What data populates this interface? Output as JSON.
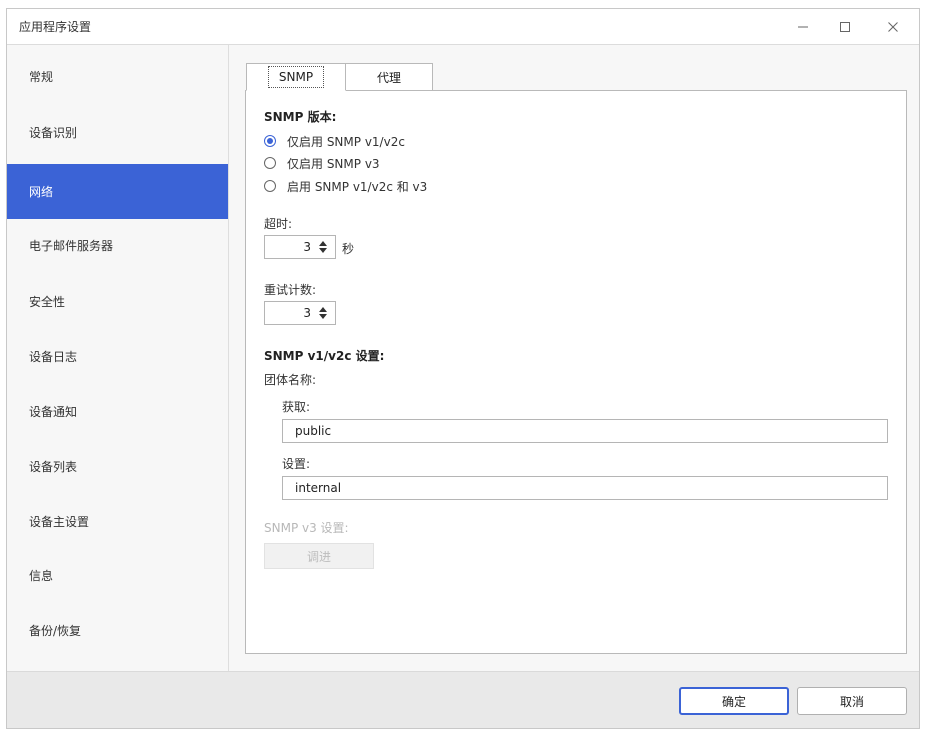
{
  "window": {
    "title": "应用程序设置",
    "minimize_icon": "minimize-icon",
    "maximize_icon": "maximize-icon",
    "close_icon": "close-icon"
  },
  "colors": {
    "accent": "#3b63d6",
    "sidebar_bg": "#f7f7f7",
    "footer_bg": "#e9e9e9"
  },
  "sidebar": {
    "items": [
      {
        "label": "常规",
        "active": false
      },
      {
        "label": "设备识别",
        "active": false
      },
      {
        "label": "网络",
        "active": true
      },
      {
        "label": "电子邮件服务器",
        "active": false
      },
      {
        "label": "安全性",
        "active": false
      },
      {
        "label": "设备日志",
        "active": false
      },
      {
        "label": "设备通知",
        "active": false
      },
      {
        "label": "设备列表",
        "active": false
      },
      {
        "label": "设备主设置",
        "active": false
      },
      {
        "label": "信息",
        "active": false
      },
      {
        "label": "备份/恢复",
        "active": false
      }
    ]
  },
  "tabs": [
    {
      "label": "SNMP",
      "active": true
    },
    {
      "label": "代理",
      "active": false
    }
  ],
  "snmp": {
    "version_title": "SNMP 版本:",
    "versions": [
      {
        "label": "仅启用 SNMP v1/v2c",
        "checked": true
      },
      {
        "label": "仅启用 SNMP v3",
        "checked": false
      },
      {
        "label": "启用 SNMP v1/v2c 和 v3",
        "checked": false
      }
    ],
    "timeout_label": "超时:",
    "timeout_value": "3",
    "timeout_unit": "秒",
    "retry_label": "重试计数:",
    "retry_value": "3",
    "v1v2c_title": "SNMP v1/v2c 设置:",
    "community_label": "团体名称:",
    "get_label": "获取:",
    "get_value": "public",
    "set_label": "设置:",
    "set_value": "internal",
    "v3_title": "SNMP v3 设置:",
    "v3_button": "调进"
  },
  "footer": {
    "ok": "确定",
    "cancel": "取消"
  }
}
